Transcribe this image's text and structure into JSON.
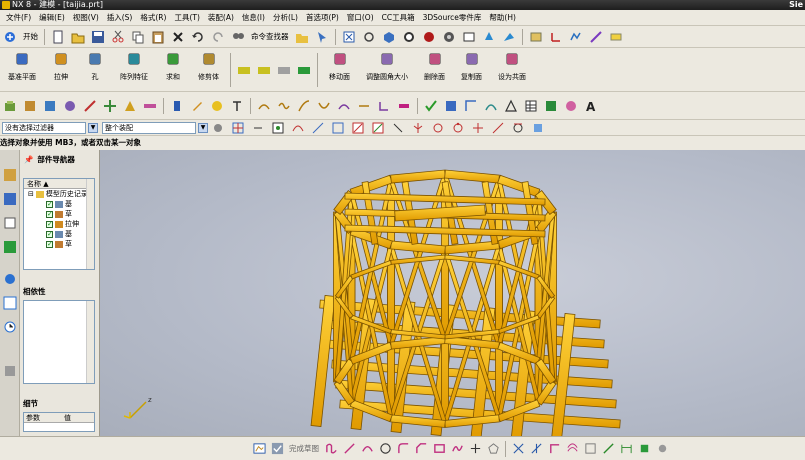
{
  "window": {
    "title": "NX 8 - 建模 - [taijia.prt]",
    "brand": "Sie"
  },
  "menu": [
    "文件(F)",
    "编辑(E)",
    "视图(V)",
    "插入(S)",
    "格式(R)",
    "工具(T)",
    "装配(A)",
    "信息(I)",
    "分析(L)",
    "首选项(P)",
    "窗口(O)",
    "CC工具箱",
    "3DSource零件库",
    "帮助(H)"
  ],
  "toolbar1": {
    "start_label": "开始",
    "command_finder_label": "命令查找器"
  },
  "feature_toolbar": [
    {
      "label": "基准平面",
      "icon": "datum-plane-icon"
    },
    {
      "label": "拉伸",
      "icon": "extrude-icon"
    },
    {
      "label": "孔",
      "icon": "hole-icon"
    },
    {
      "label": "阵列特征",
      "icon": "pattern-feature-icon"
    },
    {
      "label": "求和",
      "icon": "unite-icon"
    },
    {
      "label": "修剪体",
      "icon": "trim-body-icon"
    }
  ],
  "sync_toolbar": [
    {
      "label": "移动面",
      "icon": "move-face-icon"
    },
    {
      "label": "调整圆角大小",
      "icon": "resize-blend-icon"
    },
    {
      "label": "删除面",
      "icon": "delete-face-icon"
    },
    {
      "label": "复制面",
      "icon": "copy-face-icon"
    },
    {
      "label": "设为共面",
      "icon": "make-coplanar-icon"
    }
  ],
  "selection": {
    "filter": "没有选择过滤器",
    "scope": "整个装配"
  },
  "status": "选择对象并使用 MB3，或者双击某一对象",
  "navigator": {
    "title": "部件导航器",
    "column_name": "名称",
    "tree": [
      {
        "label": "模型历史记录",
        "type": "folder"
      },
      {
        "label": "基",
        "type": "datum"
      },
      {
        "label": "草",
        "type": "sketch"
      },
      {
        "label": "拉伸",
        "type": "extrude"
      },
      {
        "label": "基",
        "type": "datum"
      },
      {
        "label": "草",
        "type": "sketch"
      }
    ],
    "dependencies_label": "相依性",
    "details_label": "细节",
    "details_columns": [
      "参数",
      "值"
    ]
  },
  "bottom": {
    "sketch_label": "完成草图"
  },
  "colors": {
    "model": "#f0b400",
    "model_edge": "#7a5200",
    "viewport_bg": "#b8bdc9"
  }
}
